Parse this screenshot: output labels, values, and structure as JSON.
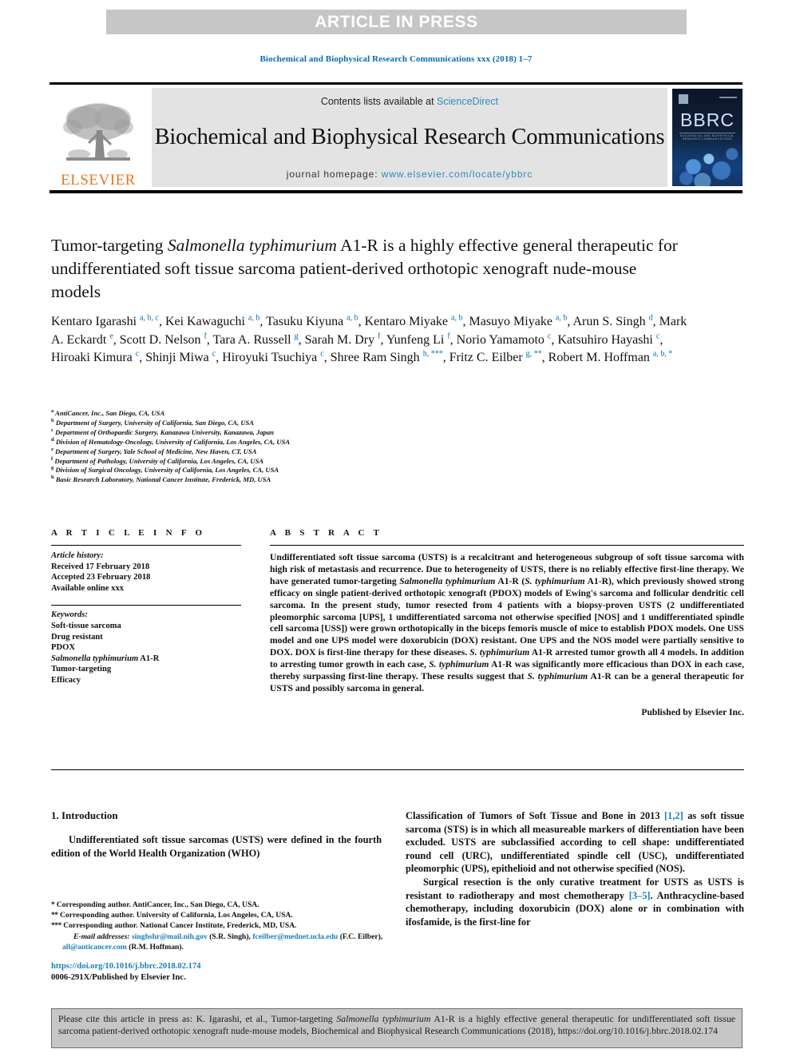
{
  "banner": {
    "label": "ARTICLE IN PRESS"
  },
  "journal_ref": "Biochemical and Biophysical Research Communications xxx (2018) 1–7",
  "masthead": {
    "publisher_name": "ELSEVIER",
    "contents_prefix": "Contents lists available at ",
    "contents_link": "ScienceDirect",
    "journal_title": "Biochemical and Biophysical Research Communications",
    "homepage_label": "journal homepage: ",
    "homepage_url": "www.elsevier.com/locate/ybbrc",
    "cover_title": "BBRC",
    "cover_subtitle": "BIOCHEMICAL AND BIOPHYSICAL RESEARCH COMMUNICATIONS"
  },
  "article": {
    "title_part1": "Tumor-targeting ",
    "title_italic": "Salmonella typhimurium",
    "title_part2": " A1-R is a highly effective general therapeutic for undifferentiated soft tissue sarcoma patient-derived orthotopic xenograft nude-mouse models",
    "authors_html": "Kentaro Igarashi <sup>a, b, c</sup>, Kei Kawaguchi <sup>a, b</sup>, Tasuku Kiyuna <sup>a, b</sup>, Kentaro Miyake <sup>a, b</sup>, Masuyo Miyake <sup>a, b</sup>, Arun S. Singh <sup>d</sup>, Mark A. Eckardt <sup>e</sup>, Scott D. Nelson <sup>f</sup>, Tara A. Russell <sup>g</sup>, Sarah M. Dry <sup>f</sup>, Yunfeng Li <sup>f</sup>, Norio Yamamoto <sup>c</sup>, Katsuhiro Hayashi <sup>c</sup>, Hiroaki Kimura <sup>c</sup>, Shinji Miwa <sup>c</sup>, Hiroyuki Tsuchiya <sup>c</sup>, Shree Ram Singh <sup>h, ***</sup>, Fritz C. Eilber <sup>g, **</sup>, Robert M. Hoffman <sup>a, b, *</sup>",
    "affiliations": [
      {
        "mark": "a",
        "text": "AntiCancer, Inc., San Diego, CA, USA"
      },
      {
        "mark": "b",
        "text": "Department of Surgery, University of California, San Diego, CA, USA"
      },
      {
        "mark": "c",
        "text": "Department of Orthopaedic Surgery, Kanazawa University, Kanazawa, Japan"
      },
      {
        "mark": "d",
        "text": "Division of Hematology-Oncology, University of California, Los Angeles, CA, USA"
      },
      {
        "mark": "e",
        "text": "Department of Surgery, Yale School of Medicine, New Haven, CT, USA"
      },
      {
        "mark": "f",
        "text": "Department of Pathology, University of California, Los Angeles, CA, USA"
      },
      {
        "mark": "g",
        "text": "Division of Surgical Oncology, University of California, Los Angeles, CA, USA"
      },
      {
        "mark": "h",
        "text": "Basic Research Laboratory, National Cancer Institute, Frederick, MD, USA"
      }
    ]
  },
  "article_info": {
    "heading": "A R T I C L E   I N F O",
    "history_label": "Article history:",
    "received": "Received 17 February 2018",
    "accepted": "Accepted 23 February 2018",
    "available": "Available online xxx",
    "keywords_label": "Keywords:",
    "keywords": [
      "Soft-tissue sarcoma",
      "Drug resistant",
      "PDOX",
      "Salmonella typhimurium A1-R",
      "Tumor-targeting",
      "Efficacy"
    ]
  },
  "abstract": {
    "heading": "A B S T R A C T",
    "body_html": "Undifferentiated soft tissue sarcoma (USTS) is a recalcitrant and heterogeneous subgroup of soft tissue sarcoma with high risk of metastasis and recurrence. Due to heterogeneity of USTS, there is no reliably effective first-line therapy. We have generated tumor-targeting <i>Salmonella typhimurium</i> A1-R (<i>S. typhimurium</i> A1-R), which previously showed strong efficacy on single patient-derived orthotopic xenograft (PDOX) models of Ewing's sarcoma and follicular dendritic cell sarcoma. In the present study, tumor resected from 4 patients with a biopsy-proven USTS (2 undifferentiated pleomorphic sarcoma [UPS], 1 undifferentiated sarcoma not otherwise specified [NOS] and 1 undifferentiated spindle cell sarcoma [USS]) were grown orthotopically in the biceps femoris muscle of mice to establish PDOX models. One USS model and one UPS model were doxorubicin (DOX) resistant. One UPS and the NOS model were partially sensitive to DOX. DOX is first-line therapy for these diseases. <i>S. typhimurium</i> A1-R arrested tumor growth all 4 models. In addition to arresting tumor growth in each case, <i>S. typhimurium</i> A1-R was significantly more efficacious than DOX in each case, thereby surpassing first-line therapy. These results suggest that <i>S. typhimurium</i> A1-R can be a general therapeutic for USTS and possibly sarcoma in general.",
    "published_by": "Published by Elsevier Inc."
  },
  "introduction": {
    "heading": "1.  Introduction",
    "left_paragraph": "Undifferentiated soft tissue sarcomas (USTS) were defined in the fourth edition of the World Health Organization (WHO)",
    "right_paragraph_1_html": "Classification of Tumors of Soft Tissue and Bone in 2013 <span class=\"ref\">[1,2]</span> as soft tissue sarcoma (STS) is in which all measureable markers of differentiation have been excluded. USTS are subclassified according to cell shape: undifferentiated round cell (URC), undifferentiated spindle cell (USC), undifferentiated pleomorphic (UPS), epithelioid and not otherwise specified (NOS).",
    "right_paragraph_2_html": "Surgical resection is the only curative treatment for USTS as USTS is resistant to radiotherapy and most chemotherapy <span class=\"ref\">[3–5]</span>. Anthracycline-based chemotherapy, including doxorubicin (DOX) alone or in combination with ifosfamide, is the first-line for"
  },
  "footnotes": {
    "corresponding_1": "Corresponding author. AntiCancer, Inc., San Diego, CA, USA.",
    "corresponding_2": "Corresponding author. University of California, Los Angeles, CA, USA.",
    "corresponding_3": "Corresponding author. National Cancer Institute, Frederick, MD, USA.",
    "email_label": "E-mail addresses:",
    "email_1": "singhshr@mail.nih.gov",
    "email_1_owner": "(S.R. Singh),",
    "email_2": "fceilber@mednet.ucla.edu",
    "email_2_owner": "(F.C. Eilber),",
    "email_3": "all@anticancer.com",
    "email_3_owner": "(R.M. Hoffman).",
    "star_1": "*",
    "star_2": "**",
    "star_3": "***"
  },
  "doi_block": {
    "doi_url": "https://doi.org/10.1016/j.bbrc.2018.02.174",
    "issn_line": "0006-291X/Published by Elsevier Inc."
  },
  "citation_box": {
    "prefix": "Please cite this article in press as: K. Igarashi, et al., Tumor-targeting ",
    "italic": "Salmonella typhimurium",
    "suffix": " A1-R is a highly effective general therapeutic for undifferentiated soft tissue sarcoma patient-derived orthotopic xenograft nude-mouse models, Biochemical and Biophysical Research Communications (2018), https://doi.org/10.1016/j.bbrc.2018.02.174"
  },
  "colors": {
    "link_blue": "#1a7fb5",
    "header_blue": "#0a6cac",
    "elsevier_orange": "#e87722",
    "banner_gray": "#c6c6c6",
    "masthead_gray": "#e3e3e3"
  }
}
